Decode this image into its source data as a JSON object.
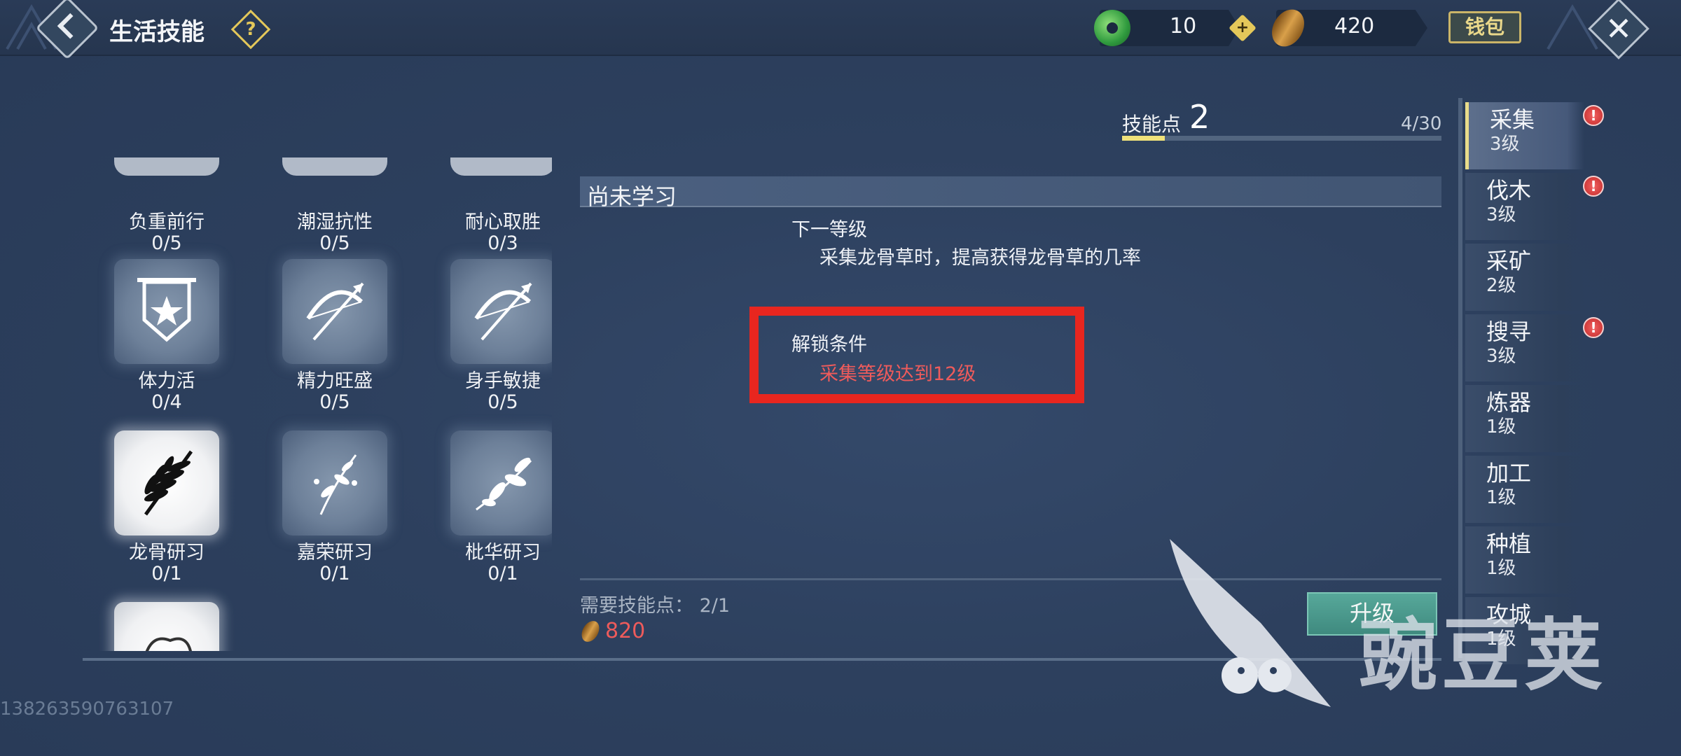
{
  "header": {
    "title": "生活技能",
    "help_symbol": "?",
    "currency_jade_value": "10",
    "currency_seed_value": "420",
    "plus_symbol": "+",
    "wallet_label": "钱包",
    "close_symbol": "✕"
  },
  "skill_points": {
    "label": "技能点",
    "value": "2",
    "progress_text": "4/30",
    "progress_fraction": 0.133
  },
  "skills": [
    {
      "name": "负重前行",
      "level": "0/5"
    },
    {
      "name": "潮湿抗性",
      "level": "0/5"
    },
    {
      "name": "耐心取胜",
      "level": "0/3"
    },
    {
      "name": "体力活",
      "level": "0/4",
      "icon": "banner-star-icon"
    },
    {
      "name": "精力旺盛",
      "level": "0/5",
      "icon": "bow-arrow-icon"
    },
    {
      "name": "身手敏捷",
      "level": "0/5",
      "icon": "bow-arrow-icon"
    },
    {
      "name": "龙骨研习",
      "level": "0/1",
      "icon": "fern-icon"
    },
    {
      "name": "嘉荣研习",
      "level": "0/1",
      "icon": "herb-sprig-icon"
    },
    {
      "name": "枇华研习",
      "level": "0/1",
      "icon": "leaf-branch-icon"
    }
  ],
  "detail": {
    "status": "尚未学习",
    "next_level_label": "下一等级",
    "next_level_desc": "采集龙骨草时，提高获得龙骨草的几率",
    "unlock_label": "解锁条件",
    "unlock_condition": "采集等级达到12级",
    "required_points": "需要技能点：  2/1",
    "cost": "820",
    "upgrade_label": "升级"
  },
  "categories": [
    {
      "name": "采集",
      "level": "3级",
      "alert": true,
      "selected": true
    },
    {
      "name": "伐木",
      "level": "3级",
      "alert": true
    },
    {
      "name": "采矿",
      "level": "2级",
      "alert": false
    },
    {
      "name": "搜寻",
      "level": "3级",
      "alert": true
    },
    {
      "name": "炼器",
      "level": "1级",
      "alert": false
    },
    {
      "name": "加工",
      "level": "1级",
      "alert": false
    },
    {
      "name": "种植",
      "level": "1级",
      "alert": false
    },
    {
      "name": "攻城",
      "level": "1级",
      "alert": false
    }
  ],
  "alert_symbol": "!",
  "footer_id": "138263590763107",
  "watermark_text": "豌豆荚",
  "colors": {
    "background": "#2c3e5c",
    "highlight_red": "#e8261f",
    "warning_text": "#ee5b5b",
    "progress_yellow": "#f0e27a",
    "button_teal": "#4f9d90"
  }
}
